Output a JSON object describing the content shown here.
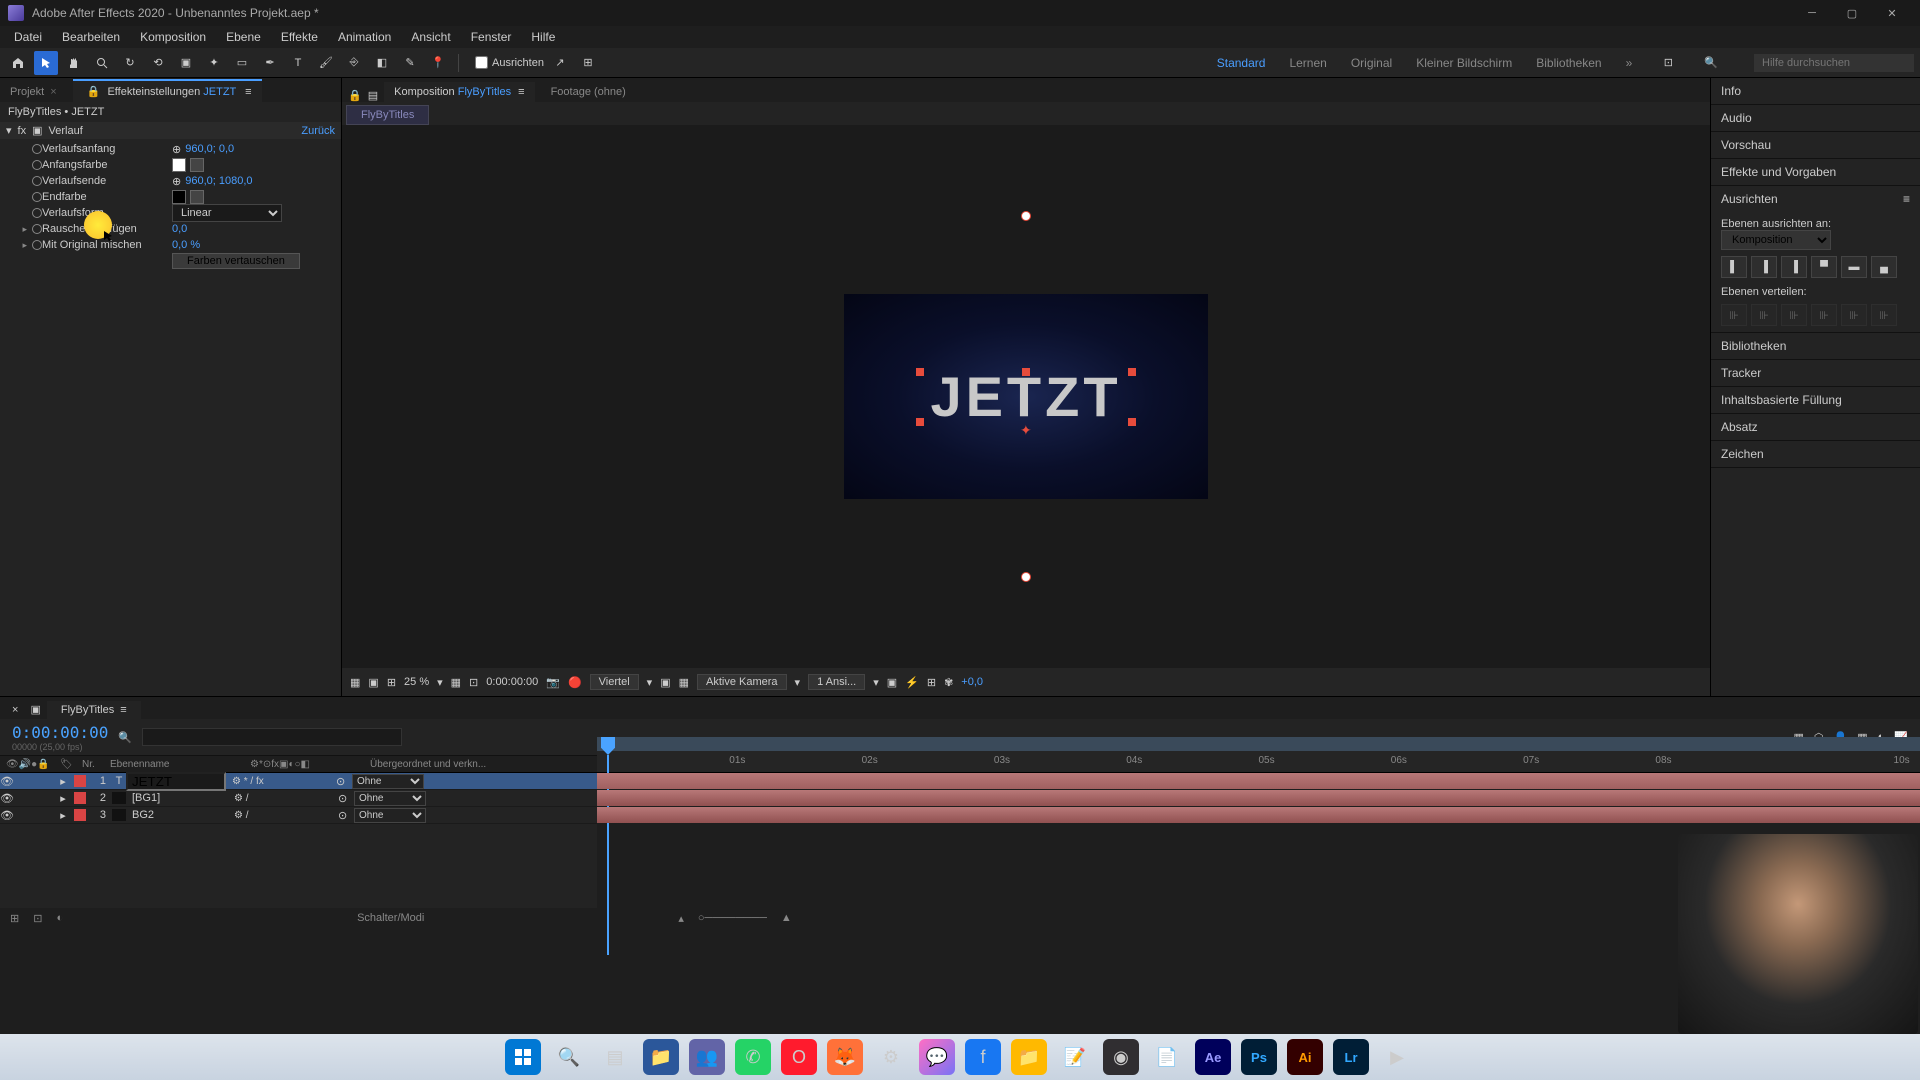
{
  "titlebar": {
    "app": "Adobe After Effects 2020 - Unbenanntes Projekt.aep *"
  },
  "menu": [
    "Datei",
    "Bearbeiten",
    "Komposition",
    "Ebene",
    "Effekte",
    "Animation",
    "Ansicht",
    "Fenster",
    "Hilfe"
  ],
  "toolbar": {
    "align_chk": "Ausrichten",
    "workspaces": [
      "Standard",
      "Lernen",
      "Original",
      "Kleiner Bildschirm",
      "Bibliotheken"
    ],
    "active_ws": "Standard",
    "search_ph": "Hilfe durchsuchen"
  },
  "left": {
    "tabs": {
      "project": "Projekt",
      "effect_controls": "Effekteinstellungen",
      "item": "JETZT"
    },
    "breadcrumb": "FlyByTitles • JETZT",
    "effect": {
      "name": "Verlauf",
      "reset": "Zurück"
    },
    "props": {
      "start": "Verlaufsanfang",
      "start_val": "960,0; 0,0",
      "startcolor": "Anfangsfarbe",
      "end": "Verlaufsende",
      "end_val": "960,0; 1080,0",
      "endcolor": "Endfarbe",
      "shape": "Verlaufsform",
      "shape_val": "Linear",
      "scatter": "Rauschen einfügen",
      "scatter_val": "0,0",
      "blend": "Mit Original mischen",
      "blend_val": "0,0 %",
      "swap": "Farben vertauschen"
    }
  },
  "center": {
    "tabs": {
      "comp": "Komposition",
      "comp_name": "FlyByTitles",
      "footage": "Footage",
      "footage_none": "(ohne)"
    },
    "chip": "FlyByTitles",
    "text": "JETZT",
    "footer": {
      "zoom": "25 %",
      "tc": "0:00:00:00",
      "res": "Viertel",
      "camera": "Aktive Kamera",
      "views": "1 Ansi...",
      "exposure": "+0,0"
    }
  },
  "right": {
    "sections": [
      "Info",
      "Audio",
      "Vorschau",
      "Effekte und Vorgaben",
      "Ausrichten",
      "Bibliotheken",
      "Tracker",
      "Inhaltsbasierte Füllung",
      "Absatz",
      "Zeichen"
    ],
    "align": {
      "label": "Ebenen ausrichten an:",
      "target": "Komposition",
      "distribute": "Ebenen verteilen:"
    }
  },
  "timeline": {
    "tab": "FlyByTitles",
    "timecode": "0:00:00:00",
    "sub": "00000 (25,00 fps)",
    "cols": {
      "nr": "Nr.",
      "name": "Ebenenname",
      "parent": "Übergeordnet und verkn..."
    },
    "parent_none": "Ohne",
    "layers": [
      {
        "n": "1",
        "name": "JETZT",
        "col": "#d94444",
        "type": "T"
      },
      {
        "n": "2",
        "name": "[BG1]",
        "col": "#d94444",
        "type": "S"
      },
      {
        "n": "3",
        "name": "BG2",
        "col": "#d94444",
        "type": "S"
      }
    ],
    "ticks": [
      "01s",
      "02s",
      "03s",
      "04s",
      "05s",
      "06s",
      "07s",
      "08s",
      "10s"
    ],
    "status": "Schalter/Modi"
  },
  "taskbar": {
    "icons": [
      "windows",
      "search",
      "tasks",
      "explorer",
      "teams",
      "whatsapp",
      "opera",
      "firefox",
      "app1",
      "messenger",
      "facebook",
      "folder",
      "app2",
      "obs",
      "notepad",
      "ae",
      "ps",
      "ai",
      "lr",
      "app3"
    ]
  }
}
